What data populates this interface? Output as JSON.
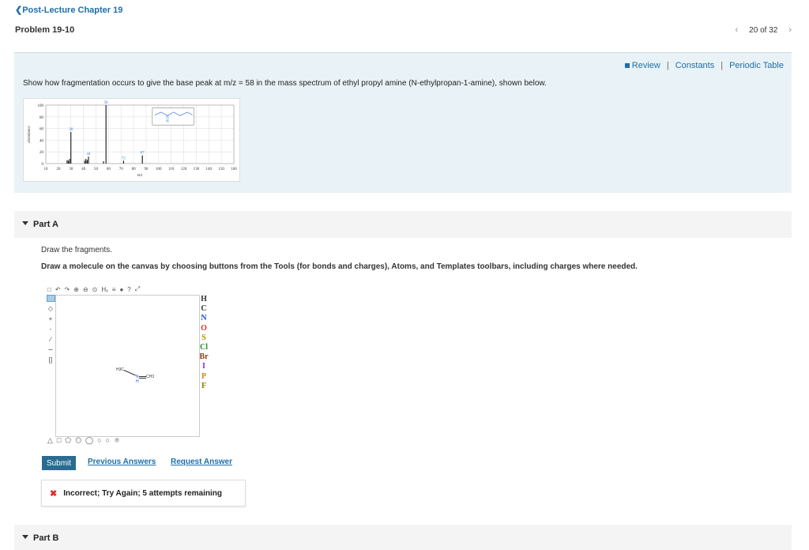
{
  "nav": {
    "back_label": "Post-Lecture Chapter 19",
    "problem_title": "Problem 19-10",
    "position": "20 of 32"
  },
  "resources": {
    "review": "Review",
    "constants": "Constants",
    "periodic_table": "Periodic Table",
    "separator": "|"
  },
  "question": "Show how fragmentation occurs to give the base peak at m/z = 58 in the mass spectrum of ethyl propyl amine (N-ethylpropan-1-amine), shown below.",
  "chart_data": {
    "type": "bar",
    "xlabel": "m/z",
    "ylabel": "abundance",
    "xlim": [
      10,
      160
    ],
    "ylim": [
      0,
      100
    ],
    "x_ticks": [
      "10",
      "20",
      "30",
      "40",
      "50",
      "60",
      "70",
      "80",
      "90",
      "100",
      "110",
      "120",
      "130",
      "140",
      "150",
      "160"
    ],
    "y_ticks": [
      "0",
      "20",
      "40",
      "60",
      "80",
      "100"
    ],
    "grid": true,
    "peaks": [
      {
        "mz": 27,
        "intensity": 6
      },
      {
        "mz": 28,
        "intensity": 5
      },
      {
        "mz": 29,
        "intensity": 8
      },
      {
        "mz": 30,
        "intensity": 54
      },
      {
        "mz": 41,
        "intensity": 5
      },
      {
        "mz": 42,
        "intensity": 8
      },
      {
        "mz": 43,
        "intensity": 6
      },
      {
        "mz": 44,
        "intensity": 12
      },
      {
        "mz": 56,
        "intensity": 4
      },
      {
        "mz": 58,
        "intensity": 100
      },
      {
        "mz": 72,
        "intensity": 5
      },
      {
        "mz": 87,
        "intensity": 14
      }
    ],
    "peak_labels": [
      {
        "mz": 58,
        "text": "58"
      },
      {
        "mz": 30,
        "text": "30"
      },
      {
        "mz": 44,
        "text": "44"
      },
      {
        "mz": 72,
        "text": "72"
      },
      {
        "mz": 87,
        "text": "87"
      }
    ],
    "inset_label_n": "N",
    "inset_label_h": "H"
  },
  "part_a": {
    "title": "Part A",
    "prompt": "Draw the fragments.",
    "instructions": "Draw a molecule on the canvas by choosing buttons from the Tools (for bonds and charges), Atoms, and Templates toolbars, including charges where needed.",
    "molecule": {
      "h3c": "H3C",
      "n": "N",
      "nh": "H",
      "ch3": "CH3"
    },
    "toolbar_top": [
      "new-icon",
      "undo-icon",
      "redo-icon",
      "zoom-in-icon",
      "zoom-out-icon",
      "zoom-reset-icon",
      "hs-icon",
      "text-icon",
      "info-icon",
      "help-icon",
      "expand-icon"
    ],
    "atoms": [
      {
        "symbol": "H",
        "color": "#333333"
      },
      {
        "symbol": "C",
        "color": "#333333"
      },
      {
        "symbol": "N",
        "color": "#1a52c9"
      },
      {
        "symbol": "O",
        "color": "#d9302b"
      },
      {
        "symbol": "S",
        "color": "#c08a00"
      },
      {
        "symbol": "Cl",
        "color": "#2e8b2e"
      },
      {
        "symbol": "Br",
        "color": "#8b3a1a"
      },
      {
        "symbol": "I",
        "color": "#8a2be2"
      },
      {
        "symbol": "P",
        "color": "#d9822b"
      },
      {
        "symbol": "F",
        "color": "#8a7a00"
      }
    ],
    "submit_label": "Submit",
    "previous_answers": "Previous Answers",
    "request_answer": "Request Answer",
    "feedback": "Incorrect; Try Again; 5 attempts remaining"
  },
  "part_b": {
    "title": "Part B"
  }
}
